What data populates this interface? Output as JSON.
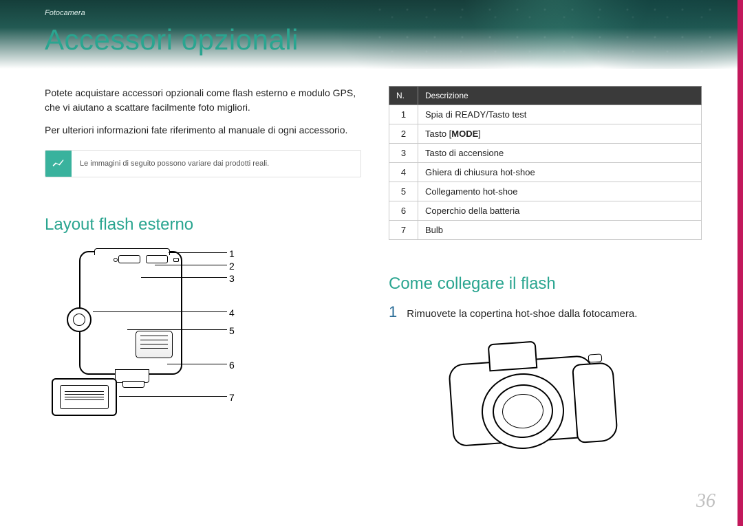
{
  "breadcrumb": "Fotocamera",
  "title": "Accessori opzionali",
  "page_number": "36",
  "left": {
    "intro": "Potete acquistare accessori opzionali come flash esterno e modulo GPS, che vi aiutano a scattare facilmente foto migliori.",
    "intro2": "Per ulteriori informazioni fate riferimento al manuale di ogni accessorio.",
    "note": "Le immagini di seguito possono variare dai prodotti reali.",
    "section_title": "Layout flash esterno",
    "labels": {
      "l1": "1",
      "l2": "2",
      "l3": "3",
      "l4": "4",
      "l5": "5",
      "l6": "6",
      "l7": "7"
    }
  },
  "right": {
    "table": {
      "head_n": "N.",
      "head_desc": "Descrizione",
      "rows": {
        "r1n": "1",
        "r1d": "Spia di READY/Tasto test",
        "r2n": "2",
        "r2d_pre": "Tasto [",
        "r2d_bold": "MODE",
        "r2d_post": "]",
        "r3n": "3",
        "r3d": "Tasto di accensione",
        "r4n": "4",
        "r4d": "Ghiera di chiusura hot-shoe",
        "r5n": "5",
        "r5d": "Collegamento hot-shoe",
        "r6n": "6",
        "r6d": "Coperchio della batteria",
        "r7n": "7",
        "r7d": "Bulb"
      }
    },
    "section_title": "Come collegare il flash",
    "step1_num": "1",
    "step1_text": "Rimuovete la copertina hot-shoe dalla fotocamera."
  }
}
